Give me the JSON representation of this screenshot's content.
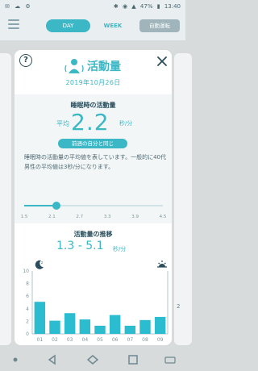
{
  "status_bar": {
    "icons_left": [
      "notification-icon",
      "cloud-icon",
      "settings-icon"
    ],
    "battery": "47%",
    "time": "13:40"
  },
  "header": {
    "tabs": [
      {
        "label": "DAY",
        "active": true
      },
      {
        "label": "WEEK",
        "active": false
      }
    ],
    "auto_button": "自動運転"
  },
  "background": {
    "left_badge": "",
    "right_badge": "2"
  },
  "card": {
    "title": "活動量",
    "date": "2019年10月26日",
    "sleep_section": {
      "title": "睡眠時の活動量",
      "avg_label": "平均",
      "avg_value": "2.2",
      "avg_unit": "秒/分",
      "compare_badge": "前週の自分と同じ",
      "description": "睡眠時の活動量の平均値を表しています。一般的に40代男性の平均値は3秒/分になります。",
      "slider": {
        "ticks": [
          "1.5",
          "2.1",
          "2.7",
          "3.3",
          "3.9",
          "4.5"
        ],
        "min": 1.5,
        "max": 4.5,
        "value": 2.2
      }
    },
    "trend_section": {
      "title": "活動量の推移",
      "range_value": "1.3 - 5.1",
      "range_unit": "秒/分"
    }
  },
  "chart_data": {
    "type": "bar",
    "title": "活動量の推移",
    "xlabel": "",
    "ylabel": "",
    "categories": [
      "01",
      "02",
      "03",
      "04",
      "05",
      "06",
      "07",
      "08",
      "09"
    ],
    "values": [
      5.1,
      2.1,
      3.3,
      2.3,
      1.3,
      3.0,
      1.3,
      2.2,
      2.7
    ],
    "ylim": [
      0,
      10
    ],
    "yticks": [
      "0",
      "2",
      "4",
      "6",
      "8",
      "10"
    ],
    "grid": false,
    "bar_color": "#2bbcd0"
  },
  "colors": {
    "accent": "#3bb7c6",
    "text": "#2a4e5c"
  }
}
